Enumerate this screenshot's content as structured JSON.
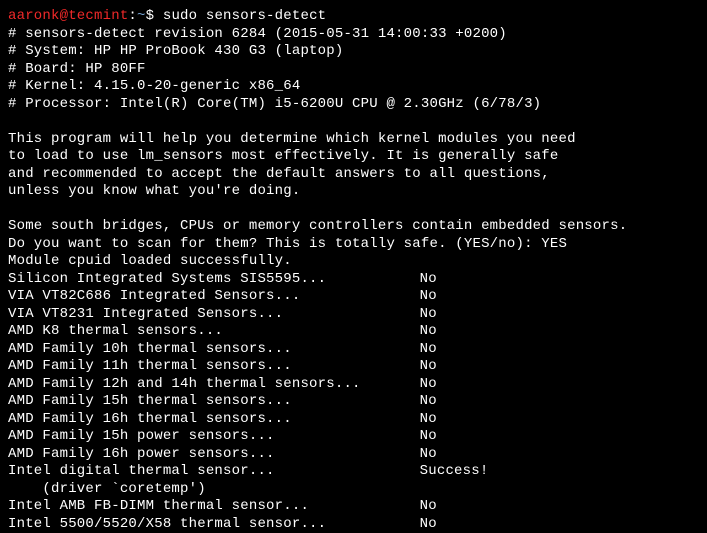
{
  "prompt": {
    "user": "aaronk@tecmint",
    "colon": ":",
    "path": "~",
    "sigil": "$ ",
    "command": "sudo sensors-detect"
  },
  "header": {
    "revision": "# sensors-detect revision 6284 (2015-05-31 14:00:33 +0200)",
    "system": "# System: HP HP ProBook 430 G3 (laptop)",
    "board": "# Board: HP 80FF",
    "kernel": "# Kernel: 4.15.0-20-generic x86_64",
    "processor": "# Processor: Intel(R) Core(TM) i5-6200U CPU @ 2.30GHz (6/78/3)"
  },
  "intro": {
    "l1": "This program will help you determine which kernel modules you need",
    "l2": "to load to use lm_sensors most effectively. It is generally safe",
    "l3": "and recommended to accept the default answers to all questions,",
    "l4": "unless you know what you're doing."
  },
  "scan": {
    "l1": "Some south bridges, CPUs or memory controllers contain embedded sensors.",
    "question": "Do you want to scan for them? This is totally safe. (YES/no): ",
    "answer": "YES",
    "module": "Module cpuid loaded successfully."
  },
  "results": [
    {
      "name": "Silicon Integrated Systems SIS5595...",
      "status": "No"
    },
    {
      "name": "VIA VT82C686 Integrated Sensors...",
      "status": "No"
    },
    {
      "name": "VIA VT8231 Integrated Sensors...",
      "status": "No"
    },
    {
      "name": "AMD K8 thermal sensors...",
      "status": "No"
    },
    {
      "name": "AMD Family 10h thermal sensors...",
      "status": "No"
    },
    {
      "name": "AMD Family 11h thermal sensors...",
      "status": "No"
    },
    {
      "name": "AMD Family 12h and 14h thermal sensors...",
      "status": "No"
    },
    {
      "name": "AMD Family 15h thermal sensors...",
      "status": "No"
    },
    {
      "name": "AMD Family 16h thermal sensors...",
      "status": "No"
    },
    {
      "name": "AMD Family 15h power sensors...",
      "status": "No"
    },
    {
      "name": "AMD Family 16h power sensors...",
      "status": "No"
    },
    {
      "name": "Intel digital thermal sensor...",
      "status": "Success!"
    }
  ],
  "driver_note": "    (driver `coretemp')",
  "results2": [
    {
      "name": "Intel AMB FB-DIMM thermal sensor...",
      "status": "No"
    },
    {
      "name": "Intel 5500/5520/X58 thermal sensor...",
      "status": "No"
    }
  ]
}
